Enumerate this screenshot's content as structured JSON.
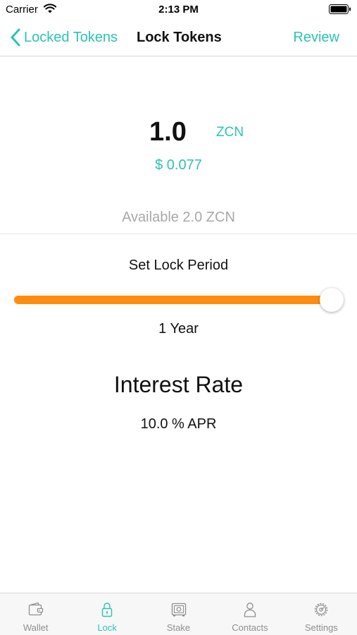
{
  "status_bar": {
    "carrier": "Carrier",
    "time": "2:13 PM"
  },
  "nav": {
    "back_label": "Locked Tokens",
    "title": "Lock Tokens",
    "action_label": "Review"
  },
  "amount": {
    "value": "1.0",
    "unit": "ZCN",
    "fiat": "$ 0.077",
    "available": "Available 2.0 ZCN"
  },
  "lock_period": {
    "heading": "Set Lock Period",
    "value_label": "1 Year",
    "slider_fraction": 1.0
  },
  "interest": {
    "heading": "Interest Rate",
    "value": "10.0 % APR"
  },
  "tabs": [
    {
      "label": "Wallet",
      "icon": "wallet-icon",
      "active": false
    },
    {
      "label": "Lock",
      "icon": "lock-icon",
      "active": true
    },
    {
      "label": "Stake",
      "icon": "safe-icon",
      "active": false
    },
    {
      "label": "Contacts",
      "icon": "person-icon",
      "active": false
    },
    {
      "label": "Settings",
      "icon": "gear-icon",
      "active": false
    }
  ],
  "colors": {
    "accent": "#2cc3b5",
    "slider": "#ff8c0f",
    "muted": "#a8a8a8",
    "inactive_tab": "#8e8e8e"
  }
}
